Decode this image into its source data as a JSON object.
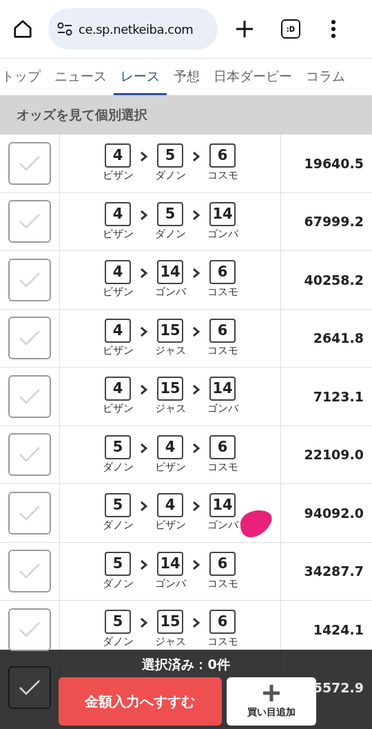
{
  "browser": {
    "url": "ce.sp.netkeiba.com",
    "tab_button": ":D"
  },
  "tabs": [
    {
      "label": "トップ",
      "selected": false
    },
    {
      "label": "ニュース",
      "selected": false
    },
    {
      "label": "レース",
      "selected": true
    },
    {
      "label": "予想",
      "selected": false
    },
    {
      "label": "日本ダービー",
      "selected": false
    },
    {
      "label": "コラム",
      "selected": false
    }
  ],
  "section_title": "オッズを見て個別選択",
  "rows": [
    {
      "checked": false,
      "picks": [
        {
          "number": "4",
          "horse": "ビザン"
        },
        {
          "number": "5",
          "horse": "ダノン"
        },
        {
          "number": "6",
          "horse": "コスモ"
        }
      ],
      "odds": "19640.5"
    },
    {
      "checked": false,
      "picks": [
        {
          "number": "4",
          "horse": "ビザン"
        },
        {
          "number": "5",
          "horse": "ダノン"
        },
        {
          "number": "14",
          "horse": "ゴンバ"
        }
      ],
      "odds": "67999.2"
    },
    {
      "checked": false,
      "picks": [
        {
          "number": "4",
          "horse": "ビザン"
        },
        {
          "number": "14",
          "horse": "ゴンバ"
        },
        {
          "number": "6",
          "horse": "コスモ"
        }
      ],
      "odds": "40258.2"
    },
    {
      "checked": false,
      "picks": [
        {
          "number": "4",
          "horse": "ビザン"
        },
        {
          "number": "15",
          "horse": "ジャス"
        },
        {
          "number": "6",
          "horse": "コスモ"
        }
      ],
      "odds": "2641.8"
    },
    {
      "checked": false,
      "picks": [
        {
          "number": "4",
          "horse": "ビザン"
        },
        {
          "number": "15",
          "horse": "ジャス"
        },
        {
          "number": "14",
          "horse": "ゴンバ"
        }
      ],
      "odds": "7123.1"
    },
    {
      "checked": false,
      "picks": [
        {
          "number": "5",
          "horse": "ダノン"
        },
        {
          "number": "4",
          "horse": "ビザン"
        },
        {
          "number": "6",
          "horse": "コスモ"
        }
      ],
      "odds": "22109.0"
    },
    {
      "checked": false,
      "picks": [
        {
          "number": "5",
          "horse": "ダノン"
        },
        {
          "number": "4",
          "horse": "ビザン"
        },
        {
          "number": "14",
          "horse": "ゴンバ"
        }
      ],
      "odds": "94092.0",
      "scribble": true
    },
    {
      "checked": false,
      "picks": [
        {
          "number": "5",
          "horse": "ダノン"
        },
        {
          "number": "14",
          "horse": "ゴンバ"
        },
        {
          "number": "6",
          "horse": "コスモ"
        }
      ],
      "odds": "34287.7"
    },
    {
      "checked": false,
      "picks": [
        {
          "number": "5",
          "horse": "ダノン"
        },
        {
          "number": "15",
          "horse": "ジャス"
        },
        {
          "number": "6",
          "horse": "コスモ"
        }
      ],
      "odds": "1424.1"
    },
    {
      "checked": false,
      "odds": "5572.9"
    }
  ],
  "footer": {
    "selected_count": "選択済み：0件",
    "proceed_button": "金額入力へすすむ",
    "add_button": "買い目追加"
  }
}
